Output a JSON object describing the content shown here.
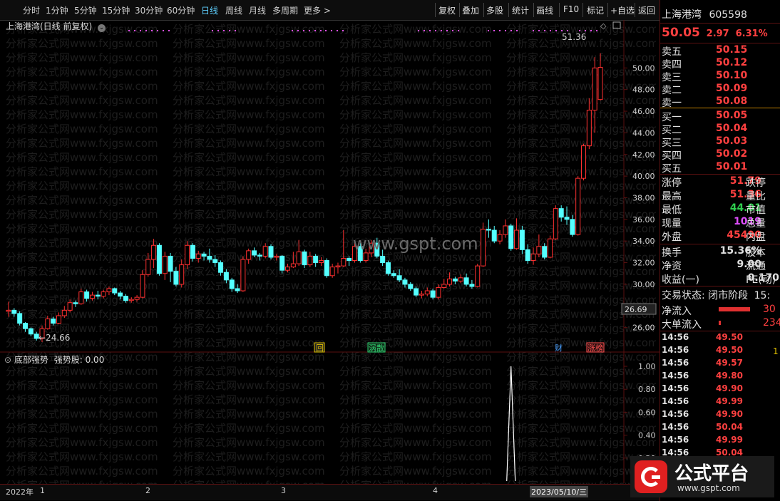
{
  "toolbar": {
    "periods": [
      "分时",
      "1分钟",
      "5分钟",
      "15分钟",
      "30分钟",
      "60分钟",
      "日线",
      "周线",
      "月线",
      "多周期",
      "更多 >"
    ],
    "active_period": "日线",
    "actions": [
      "复权",
      "叠加",
      "多股",
      "统计",
      "画线",
      "F10",
      "标记",
      "+自选",
      "返回"
    ]
  },
  "chart": {
    "title": "上海港湾(日线 前复权)",
    "high_label": "51.36",
    "low_label": "←24.66",
    "current_price_tag": "26.69",
    "price_ticks": [
      "50.00",
      "48.00",
      "46.00",
      "44.00",
      "42.00",
      "40.00",
      "38.00",
      "36.00",
      "34.00",
      "32.00",
      "30.00",
      "28.00",
      "26.00"
    ],
    "event_tags": [
      {
        "label": "回",
        "color": "#e0c000"
      },
      {
        "label": "涡散",
        "color": "#30d070"
      },
      {
        "label": "财",
        "color": "#4aa0ff"
      },
      {
        "label": "涨榜",
        "color": "#ff5050"
      }
    ],
    "watermark": "www.gspt.com",
    "watermark_repeat": "分析家公式网www.fxjgsw.com"
  },
  "indicator": {
    "title": "底部强势",
    "series_name": "强势股",
    "series_value": "0.00",
    "ticks": [
      "1.00",
      "0.80",
      "0.60",
      "0.40",
      "0.20"
    ]
  },
  "time_axis": {
    "labels": [
      "2022年",
      "1",
      "2",
      "3",
      "4"
    ],
    "cursor_date": "2023/05/10/三"
  },
  "quote": {
    "name": "上海港湾",
    "code": "605598",
    "price": "50.05",
    "change": "2.97",
    "change_pct": "6.31%",
    "asks": [
      {
        "label": "卖五",
        "price": "50.15"
      },
      {
        "label": "卖四",
        "price": "50.12"
      },
      {
        "label": "卖三",
        "price": "50.10"
      },
      {
        "label": "卖二",
        "price": "50.09"
      },
      {
        "label": "卖一",
        "price": "50.08"
      }
    ],
    "bids": [
      {
        "label": "买一",
        "price": "50.05"
      },
      {
        "label": "买二",
        "price": "50.04"
      },
      {
        "label": "买三",
        "price": "50.03"
      },
      {
        "label": "买四",
        "price": "50.02"
      },
      {
        "label": "买五",
        "price": "50.01"
      }
    ],
    "stats": [
      {
        "label": "涨停",
        "value": "51.79",
        "label2": "跌停",
        "color": "red"
      },
      {
        "label": "最高",
        "value": "51.36",
        "label2": "量比",
        "color": "red"
      },
      {
        "label": "最低",
        "value": "44.01",
        "label2": "市值",
        "color": "green"
      },
      {
        "label": "现量",
        "value": "1019",
        "label2": "总量",
        "color": "magenta"
      },
      {
        "label": "外盘",
        "value": "45490",
        "label2": "内盘",
        "color": "red"
      }
    ],
    "stats2": [
      {
        "label": "换手",
        "value": "15.36%",
        "label2": "股本"
      },
      {
        "label": "净资",
        "value": "9.00",
        "label2": "流通"
      },
      {
        "label": "收益(一)",
        "value": "0.170",
        "label2": "PE(动)"
      }
    ],
    "trade_status_label": "交易状态:",
    "trade_status": "闭市阶段",
    "trade_status_extra": "15:",
    "net_inflow_label": "净流入",
    "net_inflow_value": "30",
    "big_inflow_label": "大单流入",
    "big_inflow_value": "234",
    "ticks": [
      {
        "time": "14:56",
        "price": "49.50"
      },
      {
        "time": "14:56",
        "price": "49.50"
      },
      {
        "time": "14:56",
        "price": "49.57"
      },
      {
        "time": "14:56",
        "price": "49.80"
      },
      {
        "time": "14:56",
        "price": "49.90"
      },
      {
        "time": "14:56",
        "price": "49.99"
      },
      {
        "time": "14:56",
        "price": "49.90"
      },
      {
        "time": "14:56",
        "price": "50.04"
      },
      {
        "time": "14:56",
        "price": "49.99"
      },
      {
        "time": "14:56",
        "price": "50.04"
      }
    ],
    "tick_extra": "1"
  },
  "logo": {
    "text": "公式平台",
    "url": "www.gspt.com"
  },
  "colors": {
    "up": "#ff3030",
    "down": "#54ffff",
    "axis": "#5a1010"
  },
  "chart_data": {
    "type": "candlestick",
    "price_range": [
      25.0,
      51.5
    ],
    "candles": [
      [
        27.5,
        27.6,
        28.4,
        27.0
      ],
      [
        27.6,
        27.3,
        27.8,
        27.0
      ],
      [
        27.3,
        26.4,
        27.5,
        26.2
      ],
      [
        26.4,
        25.9,
        26.5,
        25.6
      ],
      [
        25.9,
        25.4,
        26.0,
        25.2
      ],
      [
        25.4,
        25.0,
        25.6,
        24.8
      ],
      [
        25.0,
        25.9,
        26.2,
        24.66
      ],
      [
        25.9,
        26.8,
        27.1,
        25.8
      ],
      [
        26.8,
        26.4,
        27.0,
        26.2
      ],
      [
        26.4,
        27.1,
        27.4,
        26.3
      ],
      [
        27.1,
        27.6,
        28.0,
        26.9
      ],
      [
        27.6,
        28.3,
        28.6,
        27.4
      ],
      [
        28.3,
        28.2,
        28.5,
        27.9
      ],
      [
        28.2,
        29.3,
        29.6,
        28.1
      ],
      [
        29.3,
        28.7,
        29.5,
        28.4
      ],
      [
        28.7,
        29.0,
        29.3,
        28.5
      ],
      [
        29.0,
        28.9,
        29.4,
        28.6
      ],
      [
        28.9,
        29.3,
        29.5,
        28.7
      ],
      [
        29.3,
        29.6,
        29.8,
        29.0
      ],
      [
        29.6,
        29.2,
        29.7,
        29.0
      ],
      [
        29.2,
        28.9,
        29.4,
        28.6
      ],
      [
        28.9,
        28.5,
        29.1,
        28.3
      ],
      [
        28.5,
        28.6,
        28.8,
        28.3
      ],
      [
        28.6,
        28.8,
        29.0,
        28.4
      ],
      [
        28.8,
        30.9,
        31.3,
        28.7
      ],
      [
        30.9,
        32.3,
        32.9,
        30.7
      ],
      [
        32.3,
        33.6,
        34.2,
        31.5
      ],
      [
        33.6,
        31.0,
        33.8,
        30.8
      ],
      [
        31.0,
        32.6,
        33.0,
        30.4
      ],
      [
        32.6,
        31.2,
        32.9,
        30.2
      ],
      [
        31.2,
        30.0,
        31.6,
        29.8
      ],
      [
        30.0,
        31.8,
        32.3,
        29.7
      ],
      [
        31.8,
        33.6,
        34.0,
        31.4
      ],
      [
        33.6,
        32.4,
        33.8,
        32.1
      ],
      [
        32.4,
        32.8,
        33.1,
        32.0
      ],
      [
        32.8,
        32.6,
        33.0,
        32.2
      ],
      [
        32.6,
        32.3,
        33.3,
        32.0
      ],
      [
        32.3,
        32.0,
        32.7,
        31.6
      ],
      [
        32.0,
        31.1,
        32.2,
        30.8
      ],
      [
        31.1,
        30.4,
        31.4,
        30.1
      ],
      [
        30.4,
        29.6,
        30.6,
        29.3
      ],
      [
        29.6,
        29.4,
        30.0,
        29.2
      ],
      [
        29.4,
        32.3,
        32.6,
        29.3
      ],
      [
        32.3,
        33.1,
        33.3,
        31.9
      ],
      [
        33.1,
        32.7,
        33.4,
        32.5
      ],
      [
        32.7,
        32.6,
        32.9,
        32.2
      ],
      [
        32.6,
        33.5,
        33.8,
        32.4
      ],
      [
        33.5,
        32.5,
        33.7,
        32.3
      ],
      [
        32.5,
        32.6,
        32.8,
        32.2
      ],
      [
        32.6,
        31.3,
        32.7,
        31.0
      ],
      [
        31.3,
        31.6,
        31.9,
        31.1
      ],
      [
        31.6,
        31.9,
        33.0,
        31.5
      ],
      [
        31.9,
        33.0,
        34.1,
        31.7
      ],
      [
        33.0,
        31.8,
        33.2,
        31.5
      ],
      [
        31.8,
        32.6,
        33.0,
        31.6
      ],
      [
        32.6,
        32.0,
        32.8,
        31.6
      ],
      [
        32.0,
        32.2,
        32.5,
        31.7
      ],
      [
        32.2,
        30.8,
        32.4,
        30.6
      ],
      [
        30.8,
        31.6,
        31.9,
        30.6
      ],
      [
        31.6,
        31.7,
        32.0,
        31.0
      ],
      [
        31.7,
        32.4,
        35.0,
        31.6
      ],
      [
        32.4,
        32.2,
        32.6,
        31.7
      ],
      [
        32.2,
        33.5,
        33.8,
        32.0
      ],
      [
        33.5,
        32.2,
        33.8,
        32.0
      ],
      [
        32.2,
        32.9,
        33.3,
        32.0
      ],
      [
        32.9,
        33.8,
        34.1,
        32.5
      ],
      [
        33.8,
        32.6,
        34.3,
        32.4
      ],
      [
        32.6,
        32.0,
        33.2,
        31.7
      ],
      [
        32.0,
        31.0,
        32.2,
        30.8
      ],
      [
        31.0,
        30.8,
        31.3,
        30.6
      ],
      [
        30.8,
        30.4,
        31.4,
        30.2
      ],
      [
        30.4,
        30.0,
        30.6,
        29.7
      ],
      [
        30.0,
        29.6,
        30.2,
        29.4
      ],
      [
        29.6,
        29.0,
        29.8,
        28.8
      ],
      [
        29.0,
        29.1,
        29.4,
        28.7
      ],
      [
        29.1,
        29.4,
        29.7,
        28.9
      ],
      [
        29.4,
        28.8,
        29.6,
        28.6
      ],
      [
        28.8,
        29.7,
        30.0,
        28.6
      ],
      [
        29.7,
        30.0,
        30.5,
        29.6
      ],
      [
        30.0,
        30.5,
        31.1,
        29.8
      ],
      [
        30.5,
        30.3,
        30.7,
        30.0
      ],
      [
        30.3,
        30.6,
        30.9,
        30.1
      ],
      [
        30.6,
        30.0,
        31.0,
        29.8
      ],
      [
        30.0,
        29.8,
        30.4,
        29.6
      ],
      [
        29.8,
        31.7,
        31.9,
        29.7
      ],
      [
        31.7,
        35.1,
        35.7,
        31.6
      ],
      [
        35.1,
        35.0,
        36.0,
        34.3
      ],
      [
        35.0,
        34.0,
        35.4,
        33.8
      ],
      [
        34.0,
        34.6,
        35.0,
        33.7
      ],
      [
        34.6,
        35.4,
        36.0,
        34.3
      ],
      [
        35.4,
        33.3,
        35.6,
        33.1
      ],
      [
        33.3,
        35.0,
        36.1,
        33.2
      ],
      [
        35.0,
        33.2,
        35.4,
        32.8
      ],
      [
        33.2,
        32.2,
        33.7,
        31.9
      ],
      [
        32.2,
        32.8,
        33.4,
        31.8
      ],
      [
        32.8,
        33.5,
        34.6,
        32.5
      ],
      [
        33.5,
        32.5,
        33.8,
        32.3
      ],
      [
        32.5,
        34.2,
        34.5,
        32.4
      ],
      [
        34.2,
        37.0,
        37.3,
        34.1
      ],
      [
        37.0,
        36.2,
        37.3,
        35.8
      ],
      [
        36.2,
        36.0,
        37.2,
        35.5
      ],
      [
        36.0,
        34.6,
        36.4,
        34.4
      ],
      [
        34.6,
        39.8,
        40.0,
        34.5
      ],
      [
        39.8,
        42.8,
        43.0,
        39.6
      ],
      [
        42.8,
        46.1,
        47.2,
        42.5
      ],
      [
        46.1,
        50.0,
        51.0,
        44.01
      ],
      [
        47.08,
        50.05,
        51.36,
        47.0
      ]
    ],
    "indicator": {
      "name": "强势股",
      "values_nonzero": [
        {
          "index": 90,
          "value": 1.0
        }
      ],
      "range": [
        0,
        1
      ]
    }
  }
}
